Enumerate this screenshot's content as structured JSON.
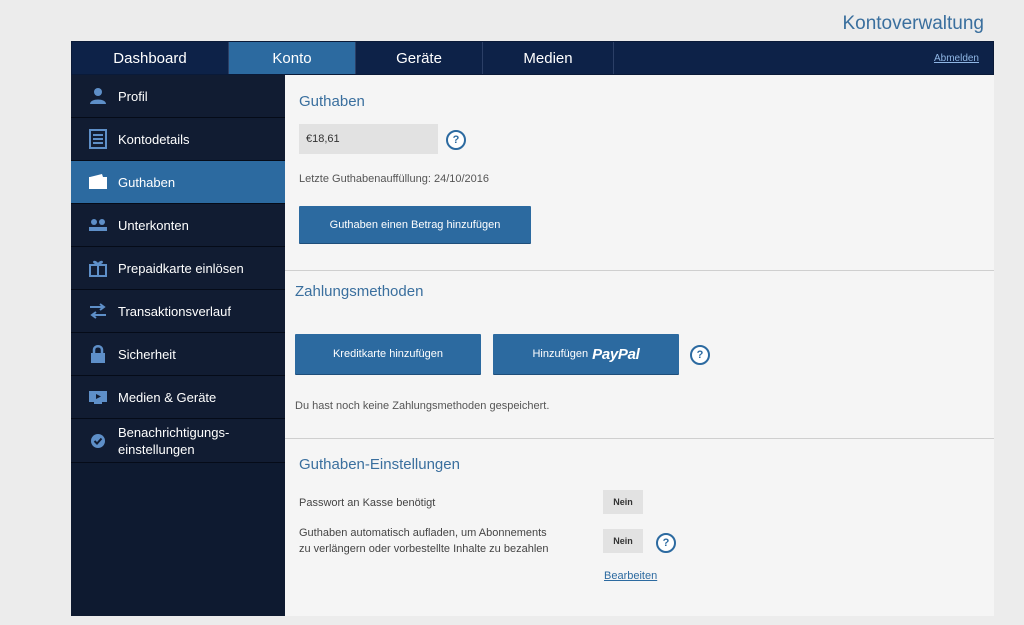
{
  "header": {
    "title": "Kontoverwaltung"
  },
  "topnav": {
    "tabs": [
      {
        "label": "Dashboard"
      },
      {
        "label": "Konto",
        "active": true
      },
      {
        "label": "Geräte"
      },
      {
        "label": "Medien"
      }
    ],
    "logout_label": "Abmelden"
  },
  "sidebar": {
    "items": [
      {
        "label": "Profil",
        "icon": "user-icon"
      },
      {
        "label": "Kontodetails",
        "icon": "document-icon"
      },
      {
        "label": "Guthaben",
        "icon": "wallet-icon",
        "active": true
      },
      {
        "label": "Unterkonten",
        "icon": "users-icon"
      },
      {
        "label": "Prepaidkarte einlösen",
        "icon": "gift-icon"
      },
      {
        "label": "Transaktionsverlauf",
        "icon": "transfer-icon"
      },
      {
        "label": "Sicherheit",
        "icon": "lock-icon"
      },
      {
        "label": "Medien & Geräte",
        "icon": "media-icon"
      },
      {
        "label_line1": "Benachrichtigungs-",
        "label_line2": "einstellungen",
        "icon": "check-badge-icon"
      }
    ]
  },
  "balance": {
    "title": "Guthaben",
    "value": "€18,61",
    "help": "?",
    "last_topup": "Letzte Guthabenauffüllung: 24/10/2016",
    "add_button": "Guthaben einen Betrag hinzufügen"
  },
  "payment": {
    "title": "Zahlungsmethoden",
    "credit_card_button": "Kreditkarte hinzufügen",
    "paypal_prefix": "Hinzufügen",
    "paypal_brand": "PayPal",
    "help": "?",
    "empty_text": "Du hast noch keine Zahlungsmethoden gespeichert."
  },
  "settings": {
    "title": "Guthaben-Einstellungen",
    "password_label": "Passwort an Kasse benötigt",
    "password_value": "Nein",
    "autoload_label_line1": "Guthaben automatisch aufladen, um Abonnements",
    "autoload_label_line2": "zu verlängern oder vorbestellte Inhalte zu bezahlen",
    "autoload_value": "Nein",
    "help": "?",
    "edit_link": "Bearbeiten"
  },
  "colors": {
    "nav_bg": "#0d2248",
    "accent": "#2c6aa0",
    "sidebar_bg": "#111c32",
    "title_blue": "#3a6f9e"
  }
}
